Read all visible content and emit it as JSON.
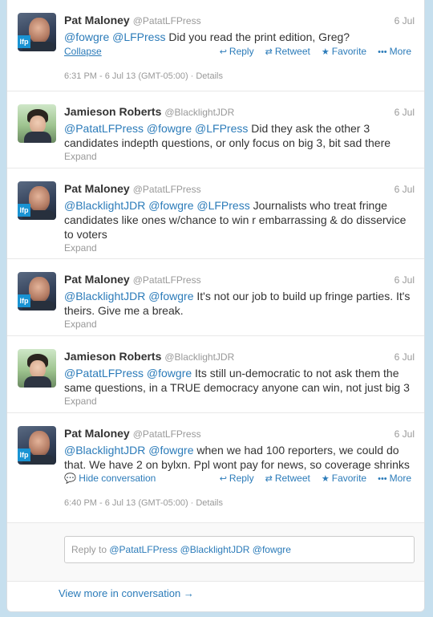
{
  "tweets": [
    {
      "name": "Pat Maloney",
      "handle": "@PatatLFPress",
      "date": "6 Jul",
      "segments": [
        {
          "t": "@fowgre",
          "m": true
        },
        {
          "t": " "
        },
        {
          "t": "@LFPress",
          "m": true
        },
        {
          "t": " Did you read the print edition, Greg?"
        }
      ],
      "toggle": "Collapse",
      "meta_time": "6:31 PM - 6 Jul 13 (GMT-05:00)",
      "meta_details": "Details"
    },
    {
      "name": "Jamieson Roberts",
      "handle": "@BlacklightJDR",
      "date": "6 Jul",
      "segments": [
        {
          "t": "@PatatLFPress",
          "m": true
        },
        {
          "t": " "
        },
        {
          "t": "@fowgre",
          "m": true
        },
        {
          "t": " "
        },
        {
          "t": "@LFPress",
          "m": true
        },
        {
          "t": " Did they ask the other 3 candidates indepth questions, or only focus on big 3, bit sad there"
        }
      ],
      "toggle": "Expand"
    },
    {
      "name": "Pat Maloney",
      "handle": "@PatatLFPress",
      "date": "6 Jul",
      "segments": [
        {
          "t": "@BlacklightJDR",
          "m": true
        },
        {
          "t": " "
        },
        {
          "t": "@fowgre",
          "m": true
        },
        {
          "t": " "
        },
        {
          "t": "@LFPress",
          "m": true
        },
        {
          "t": " Journalists who treat fringe candidates like ones w/chance to win r embarrassing & do disservice to voters"
        }
      ],
      "toggle": "Expand"
    },
    {
      "name": "Pat Maloney",
      "handle": "@PatatLFPress",
      "date": "6 Jul",
      "segments": [
        {
          "t": "@BlacklightJDR",
          "m": true
        },
        {
          "t": " "
        },
        {
          "t": "@fowgre",
          "m": true
        },
        {
          "t": " It's not our job to build up fringe parties. It's theirs. Give me a break."
        }
      ],
      "toggle": "Expand"
    },
    {
      "name": "Jamieson Roberts",
      "handle": "@BlacklightJDR",
      "date": "6 Jul",
      "segments": [
        {
          "t": "@PatatLFPress",
          "m": true
        },
        {
          "t": " "
        },
        {
          "t": "@fowgre",
          "m": true
        },
        {
          "t": " Its still un-democratic to not ask them the same questions, in a TRUE democracy anyone can win, not just big 3"
        }
      ],
      "toggle": "Expand"
    },
    {
      "name": "Pat Maloney",
      "handle": "@PatatLFPress",
      "date": "6 Jul",
      "segments": [
        {
          "t": "@BlacklightJDR",
          "m": true
        },
        {
          "t": " "
        },
        {
          "t": "@fowgre",
          "m": true
        },
        {
          "t": " when we had 100 reporters, we could do that. We have 2 on bylxn. Ppl wont pay for news, so coverage shrinks"
        }
      ],
      "toggle": "Hide conversation",
      "meta_time": "6:40 PM - 6 Jul 13 (GMT-05:00)",
      "meta_details": "Details"
    }
  ],
  "actions": {
    "reply": "Reply",
    "retweet": "Retweet",
    "favorite": "Favorite",
    "more": "More"
  },
  "reply_box": {
    "prefix": "Reply to ",
    "mentions": "@PatatLFPress @BlacklightJDR @fowgre"
  },
  "view_more": "View more in conversation →",
  "colors": {
    "link": "#2b7bb9",
    "muted": "#999999",
    "background": "#c6dfee"
  }
}
